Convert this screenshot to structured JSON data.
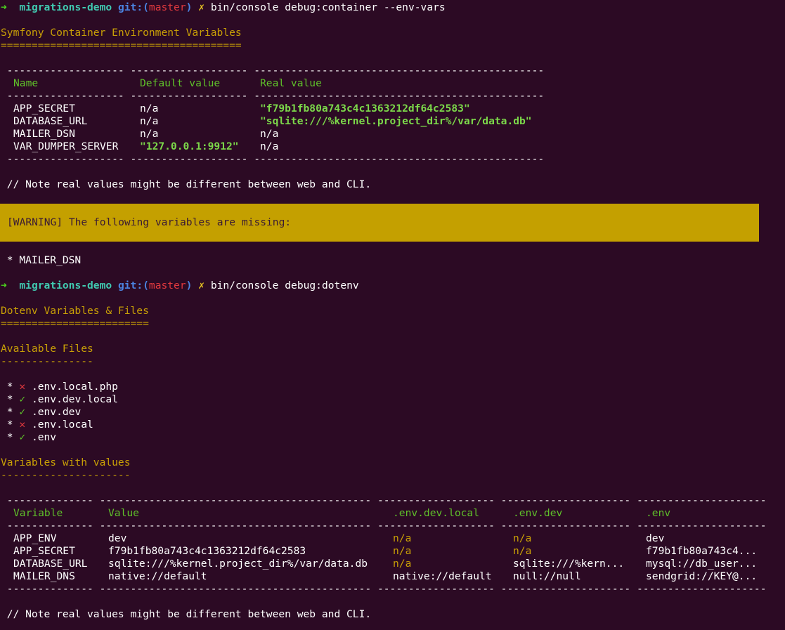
{
  "prompt": {
    "arrow": "➜",
    "dir": "migrations-demo",
    "git_open": "git:(",
    "branch": "master",
    "git_close": ")",
    "dirty": "✗"
  },
  "commands": {
    "first": "bin/console debug:container --env-vars",
    "second": "bin/console debug:dotenv"
  },
  "container": {
    "title": "Symfony Container Environment Variables",
    "title_underline": "=======================================",
    "table_rule": " ------------------- ------------------- -----------------------------------------------",
    "headers": {
      "name": "Name",
      "default": "Default value",
      "real": "Real value"
    },
    "rows": [
      {
        "name": "APP_SECRET",
        "default": "n/a",
        "real": "\"f79b1fb80a743c4c1363212df64c2583\""
      },
      {
        "name": "DATABASE_URL",
        "default": "n/a",
        "real": "\"sqlite:///%kernel.project_dir%/var/data.db\""
      },
      {
        "name": "MAILER_DSN",
        "default": "n/a",
        "real": "n/a"
      },
      {
        "name": "VAR_DUMPER_SERVER",
        "default": "\"127.0.0.1:9912\"",
        "real": "n/a"
      }
    ],
    "note": " // Note real values might be different between web and CLI.",
    "warning": "[WARNING] The following variables are missing:",
    "missing": [
      " * MAILER_DSN"
    ]
  },
  "dotenv": {
    "title": "Dotenv Variables & Files",
    "title_underline": "========================",
    "files_title": "Available Files",
    "files_underline": "---------------",
    "files": [
      {
        "bullet": " * ",
        "status": "missing",
        "mark": "✕",
        "name": ".env.local.php"
      },
      {
        "bullet": " * ",
        "status": "present",
        "mark": "✓",
        "name": ".env.dev.local"
      },
      {
        "bullet": " * ",
        "status": "present",
        "mark": "✓",
        "name": ".env.dev"
      },
      {
        "bullet": " * ",
        "status": "missing",
        "mark": "✕",
        "name": ".env.local"
      },
      {
        "bullet": " * ",
        "status": "present",
        "mark": "✓",
        "name": ".env"
      }
    ],
    "vars_title": "Variables with values",
    "vars_underline": "---------------------",
    "table_rule": " -------------- -------------------------------------------- ------------------- --------------------- ---------------------",
    "headers": {
      "variable": "Variable",
      "value": "Value",
      "dev_local": ".env.dev.local",
      "dev": ".env.dev",
      "env": ".env"
    },
    "rows": [
      {
        "variable": "APP_ENV",
        "value": "dev",
        "dev_local": "n/a",
        "dev": "n/a",
        "env": "dev"
      },
      {
        "variable": "APP_SECRET",
        "value": "f79b1fb80a743c4c1363212df64c2583",
        "dev_local": "n/a",
        "dev": "n/a",
        "env": "f79b1fb80a743c4..."
      },
      {
        "variable": "DATABASE_URL",
        "value": "sqlite:///%kernel.project_dir%/var/data.db",
        "dev_local": "n/a",
        "dev": "sqlite:///%kern...",
        "env": "mysql://db_user..."
      },
      {
        "variable": "MAILER_DNS",
        "value": "native://default",
        "dev_local": "native://default",
        "dev": "null://null",
        "env": "sendgrid://KEY@..."
      }
    ],
    "note": " // Note real values might be different between web and CLI."
  },
  "colors": {
    "background": "#2c0a24",
    "warning_bg": "#c4a000",
    "heading": "#c9a006",
    "green": "#5fc02a",
    "red": "#e0393e"
  }
}
